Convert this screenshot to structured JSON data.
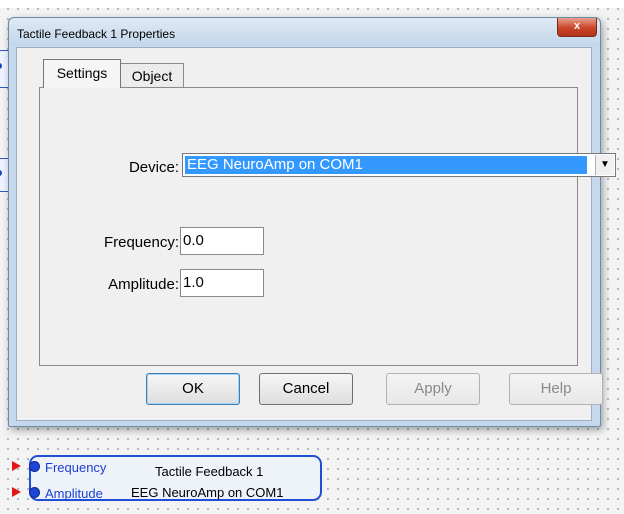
{
  "dialog": {
    "title": "Tactile Feedback 1 Properties",
    "close_label": "x",
    "tabs": [
      {
        "label": "Settings",
        "active": true
      },
      {
        "label": "Object",
        "active": false
      }
    ],
    "device": {
      "label": "Device:",
      "value": "EEG NeuroAmp on COM1"
    },
    "frequency": {
      "label": "Frequency:",
      "value": "0.0"
    },
    "amplitude": {
      "label": "Amplitude:",
      "value": "1.0"
    },
    "buttons": {
      "ok": "OK",
      "cancel": "Cancel",
      "apply": "Apply",
      "help": "Help"
    }
  },
  "node": {
    "ports": [
      {
        "label": "Frequency"
      },
      {
        "label": "Amplitude"
      }
    ],
    "title": "Tactile Feedback 1",
    "subtitle": "EEG NeuroAmp on COM1"
  },
  "colors": {
    "port_arrow": "#e01818",
    "port_dot": "#1d46d9",
    "node_border": "#1f4fd6",
    "selection": "#3399ff"
  }
}
